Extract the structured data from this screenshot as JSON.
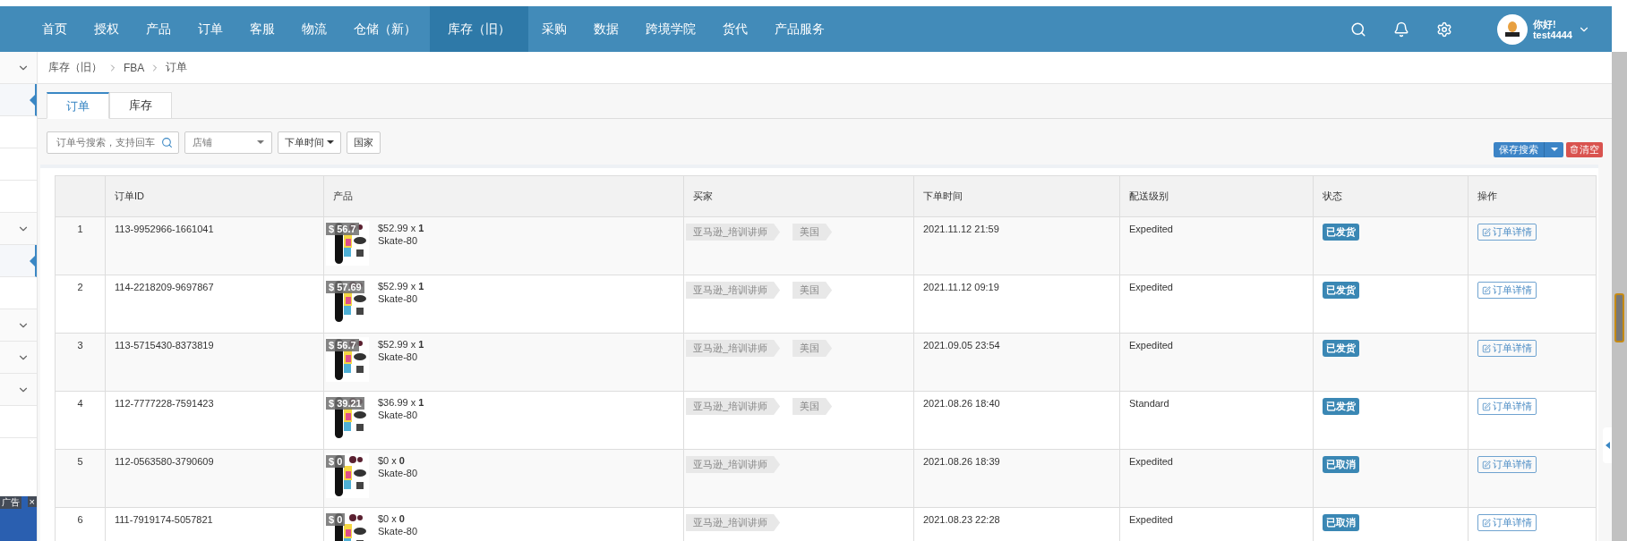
{
  "nav": {
    "items": [
      {
        "label": "首页",
        "selected": false
      },
      {
        "label": "授权",
        "selected": false
      },
      {
        "label": "产品",
        "selected": false
      },
      {
        "label": "订单",
        "selected": false
      },
      {
        "label": "客服",
        "selected": false
      },
      {
        "label": "物流",
        "selected": false
      },
      {
        "label": "仓储（新）",
        "selected": false
      },
      {
        "label": "库存（旧）",
        "selected": true
      },
      {
        "label": "采购",
        "selected": false
      },
      {
        "label": "数据",
        "selected": false
      },
      {
        "label": "跨境学院",
        "selected": false
      },
      {
        "label": "货代",
        "selected": false
      },
      {
        "label": "产品服务",
        "selected": false
      }
    ],
    "user": {
      "greeting": "你好!",
      "name": "test4444"
    }
  },
  "sidebar": {
    "entries": [
      {
        "kind": "group",
        "selected": false
      },
      {
        "kind": "item",
        "selected": true
      },
      {
        "kind": "item",
        "selected": false
      },
      {
        "kind": "item",
        "selected": false
      },
      {
        "kind": "item",
        "selected": false
      },
      {
        "kind": "group",
        "selected": false
      },
      {
        "kind": "item",
        "selected": true
      },
      {
        "kind": "item",
        "selected": false
      },
      {
        "kind": "group",
        "selected": false
      },
      {
        "kind": "group",
        "selected": false
      },
      {
        "kind": "group",
        "selected": false
      },
      {
        "kind": "item",
        "selected": false
      }
    ],
    "ad": {
      "label": "广告",
      "close": "×"
    }
  },
  "breadcrumb": [
    "库存（旧）",
    "FBA",
    "订单"
  ],
  "tabs": [
    {
      "label": "订单",
      "selected": true
    },
    {
      "label": "库存",
      "selected": false
    }
  ],
  "filters": {
    "search": {
      "placeholder": "订单号搜索，支持回车"
    },
    "shop": {
      "placeholder": "店铺"
    },
    "time_button": "下单时间",
    "country_button": "国家",
    "save_button": "保存搜索",
    "clear_button": "清空"
  },
  "table": {
    "columns": [
      "",
      "订单ID",
      "产品",
      "买家",
      "下单时间",
      "配送级别",
      "状态",
      "操作"
    ],
    "rows": [
      {
        "index": "1",
        "order_id": "113-9952966-1661041",
        "price_tag": "$ 56.7",
        "price_line": "$52.99 x **1**",
        "sku": "Skate-80",
        "buyer_tags": [
          "亚马逊_培训讲师",
          "美国"
        ],
        "time": "2021.11.12 21:59",
        "shipping": "Expedited",
        "status": "已发货",
        "action": "订单详情"
      },
      {
        "index": "2",
        "order_id": "114-2218209-9697867",
        "price_tag": "$ 57.69",
        "price_line": "$52.99 x **1**",
        "sku": "Skate-80",
        "buyer_tags": [
          "亚马逊_培训讲师",
          "美国"
        ],
        "time": "2021.11.12 09:19",
        "shipping": "Expedited",
        "status": "已发货",
        "action": "订单详情"
      },
      {
        "index": "3",
        "order_id": "113-5715430-8373819",
        "price_tag": "$ 56.7",
        "price_line": "$52.99 x **1**",
        "sku": "Skate-80",
        "buyer_tags": [
          "亚马逊_培训讲师",
          "美国"
        ],
        "time": "2021.09.05 23:54",
        "shipping": "Expedited",
        "status": "已发货",
        "action": "订单详情"
      },
      {
        "index": "4",
        "order_id": "112-7777228-7591423",
        "price_tag": "$ 39.21",
        "price_line": "$36.99 x **1**",
        "sku": "Skate-80",
        "buyer_tags": [
          "亚马逊_培训讲师",
          "美国"
        ],
        "time": "2021.08.26 18:40",
        "shipping": "Standard",
        "status": "已发货",
        "action": "订单详情"
      },
      {
        "index": "5",
        "order_id": "112-0563580-3790609",
        "price_tag": "$ 0",
        "price_line": "$0 x **0**",
        "sku": "Skate-80",
        "buyer_tags": [
          "亚马逊_培训讲师"
        ],
        "time": "2021.08.26 18:39",
        "shipping": "Expedited",
        "status": "已取消",
        "action": "订单详情"
      },
      {
        "index": "6",
        "order_id": "111-7919174-5057821",
        "price_tag": "$ 0",
        "price_line": "$0 x **0**",
        "sku": "Skate-80",
        "buyer_tags": [
          "亚马逊_培训讲师"
        ],
        "time": "2021.08.23 22:28",
        "shipping": "Expedited",
        "status": "已取消",
        "action": "订单详情"
      }
    ]
  }
}
